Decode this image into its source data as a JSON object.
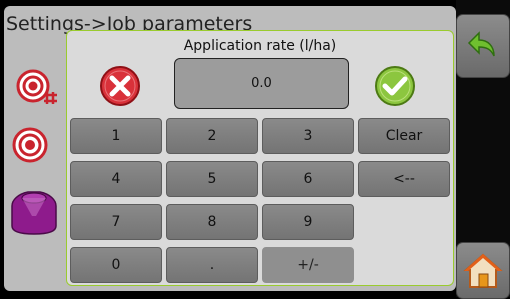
{
  "header": {
    "title": "Settings->Job parameters"
  },
  "dialog": {
    "title": "Application rate (l/ha)",
    "value": "0.0"
  },
  "keypad": {
    "row1": [
      "1",
      "2",
      "3",
      "Clear"
    ],
    "row2": [
      "4",
      "5",
      "6",
      "<--"
    ],
    "row3": [
      "7",
      "8",
      "9"
    ],
    "row4": [
      "0",
      ".",
      "+/-"
    ]
  },
  "icons": {
    "cancel": "cancel-icon",
    "confirm": "confirm-icon",
    "back": "back-arrow-icon",
    "home": "home-icon",
    "target_hash": "target-hash-icon",
    "target": "target-icon",
    "nozzle": "nozzle-icon"
  },
  "colors": {
    "cancel_red": "#d9313a",
    "confirm_green": "#8cc63f",
    "dialog_border": "#9acb2e"
  }
}
